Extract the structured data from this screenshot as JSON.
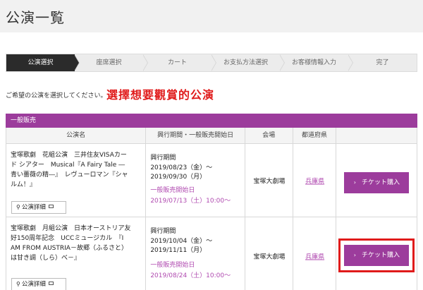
{
  "page": {
    "title": "公演一覧"
  },
  "steps": [
    {
      "label": "公演選択",
      "active": true
    },
    {
      "label": "座席選択",
      "active": false
    },
    {
      "label": "カート",
      "active": false
    },
    {
      "label": "お支払方法選択",
      "active": false
    },
    {
      "label": "お客様情報入力",
      "active": false
    },
    {
      "label": "完了",
      "active": false
    }
  ],
  "instruction": "ご希望の公演を選択してください。",
  "annotation": "選擇想要觀賞的公演",
  "section": {
    "title": "一般販売"
  },
  "table": {
    "headers": [
      "公演名",
      "興行期間・一般販売開始日",
      "会場",
      "都道府県",
      ""
    ],
    "rows": [
      {
        "title_lines": [
          "宝塚歌劇　花組公演　三井住友VISAカー",
          "ド シアター　Musical『A Fairy Tale ―",
          "青い薔薇の精―』　レヴューロマン『シャ",
          "ルム！』"
        ],
        "detail_label": "公演詳細",
        "period_label": "興行期間",
        "period_start": "2019/08/23（金）～",
        "period_end": "2019/09/30（月）",
        "sale_label": "一般販売開始日",
        "sale_date": "2019/07/13（土）10:00～",
        "venue": "宝塚大劇場",
        "prefecture": "兵庫県",
        "buy_label": "チケット購入",
        "highlighted": false
      },
      {
        "title_lines": [
          "宝塚歌劇　月組公演　日本オーストリア友",
          "好150周年記念　UCCミュージカル　『I",
          "AM FROM AUSTRIA－故郷（ふるさと）",
          "は甘き調（しら）べ－』"
        ],
        "detail_label": "公演詳細",
        "period_label": "興行期間",
        "period_start": "2019/10/04（金）～",
        "period_end": "2019/11/11（月）",
        "sale_label": "一般販売開始日",
        "sale_date": "2019/08/24（土）10:00～",
        "venue": "宝塚大劇場",
        "prefecture": "兵庫県",
        "buy_label": "チケット購入",
        "highlighted": true
      }
    ]
  },
  "colors": {
    "accent": "#9c3c9c",
    "annotation": "#e01b1b",
    "step_active": "#2b2b2b"
  }
}
